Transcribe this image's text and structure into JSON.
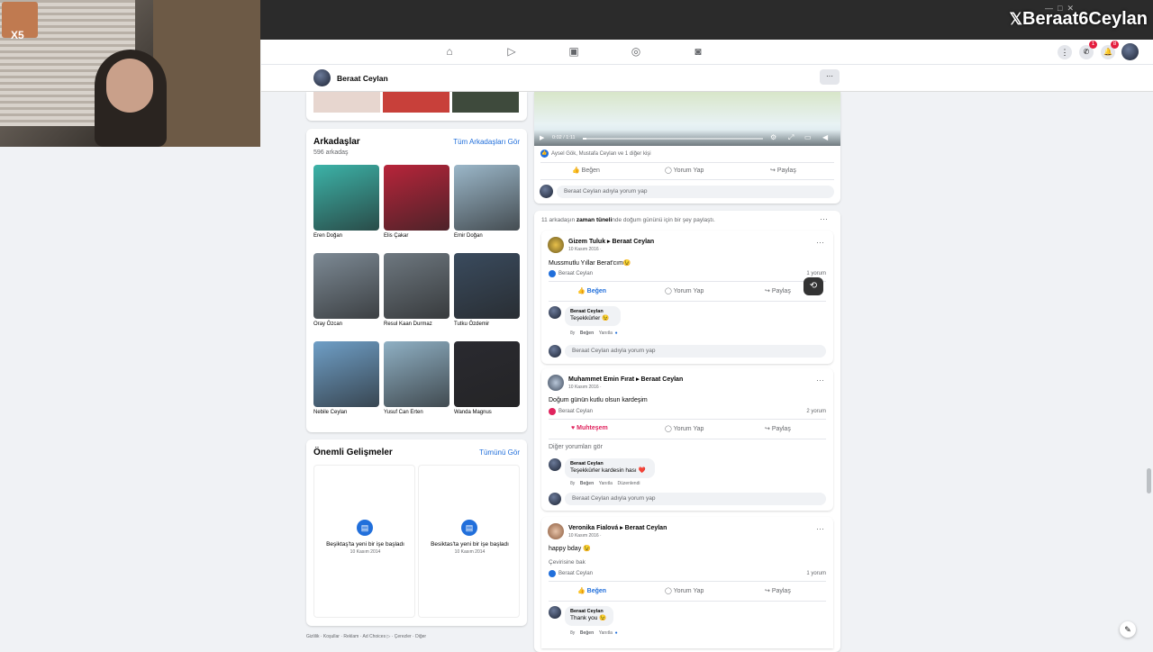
{
  "overlay": {
    "watermark": "Beraat6Ceylan",
    "x5": "X5"
  },
  "nav": {
    "badges": {
      "messenger": "1",
      "notifications": "8"
    }
  },
  "profile_bar": {
    "name": "Beraat Ceylan",
    "more": "···"
  },
  "friends": {
    "title": "Arkadaşlar",
    "see_all": "Tüm Arkadaşları Gör",
    "count": "596 arkadaş",
    "items": [
      {
        "name": "Eren Doğan",
        "color": "#3cb3a8"
      },
      {
        "name": "Elis Çakar",
        "color": "#b8243a"
      },
      {
        "name": "Emir Doğan",
        "color": "#9bb7c9"
      },
      {
        "name": "Oray Özcan",
        "color": "#7d8a95"
      },
      {
        "name": "Resul Kaan Durmaz",
        "color": "#6e7880"
      },
      {
        "name": "Tutku Özdemir",
        "color": "#3a4b5e"
      },
      {
        "name": "Nebile Ceylan",
        "color": "#6f9fc7"
      },
      {
        "name": "Yusuf Can Erten",
        "color": "#8fb0c4"
      },
      {
        "name": "Wanda Magnus",
        "color": "#2a2a30"
      }
    ]
  },
  "events": {
    "title": "Önemli Gelişmeler",
    "see_all": "Tümünü Gör",
    "items": [
      {
        "text": "Beşiktaş'ta yeni bir işe başladı",
        "date": "10 Kasım 2014"
      },
      {
        "text": "Besiktas'ta yeni bir işe başladı",
        "date": "10 Kasım 2014"
      }
    ]
  },
  "footer": "Gizlilik · Koşullar · Reklam · Ad Choices ▷ · Çerezler · Diğer",
  "video": {
    "time": "0:02 / 1:11",
    "reactions": "Aysel Gök, Mustafa Ceylan ve 1 diğer kişi",
    "like": "Beğen",
    "comment": "Yorum Yap",
    "share": "Paylaş",
    "comment_placeholder": "Beraat Ceylan adıyla yorum yap"
  },
  "birthday": {
    "header": "11 arkadaşın zaman tünelinde doğum gününü için bir şey paylaştı.",
    "header_bold": "zaman tüneli",
    "posts": [
      {
        "author": "Gizem Tuluk",
        "target": "Beraat Ceylan",
        "date": "10 Kasım 2016 · ",
        "text": "Mussmutlu Yıllar Berat'cım😉",
        "reactor": "Beraat Ceylan",
        "comments_count": "1 yorum",
        "action": "Beğen",
        "reply_name": "Beraat Ceylan",
        "reply_text": "Teşekkürler 😉",
        "reply_actions": [
          "8y",
          "Beğen",
          "Yanıtla"
        ]
      },
      {
        "author": "Muhammet Emin Fırat",
        "target": "Beraat Ceylan",
        "date": "10 Kasım 2016 · ",
        "text": "Doğum günün kutlu olsun kardeşim",
        "reactor": "Beraat Ceylan",
        "comments_count": "2 yorum",
        "action": "Muhteşem",
        "more_comments": "Diğer yorumları gör",
        "reply_name": "Beraat Ceylan",
        "reply_text": "Teşekkürler kardesin hası ❤️",
        "reply_actions": [
          "8y",
          "Beğen",
          "Yanıtla",
          "Düzenlendi"
        ]
      },
      {
        "author": "Veronika Fialová",
        "target": "Beraat Ceylan",
        "date": "10 Kasım 2016 · ",
        "text": "happy bday 😉",
        "translate": "Çevirisine bak",
        "reactor": "Beraat Ceylan",
        "comments_count": "1 yorum",
        "action": "Beğen",
        "reply_name": "Beraat Ceylan",
        "reply_text": "Thank you 😉",
        "reply_actions": [
          "8y",
          "Beğen",
          "Yanıtla"
        ]
      }
    ]
  },
  "colors": {
    "accent": "#216fdb",
    "love": "#e0245e"
  }
}
